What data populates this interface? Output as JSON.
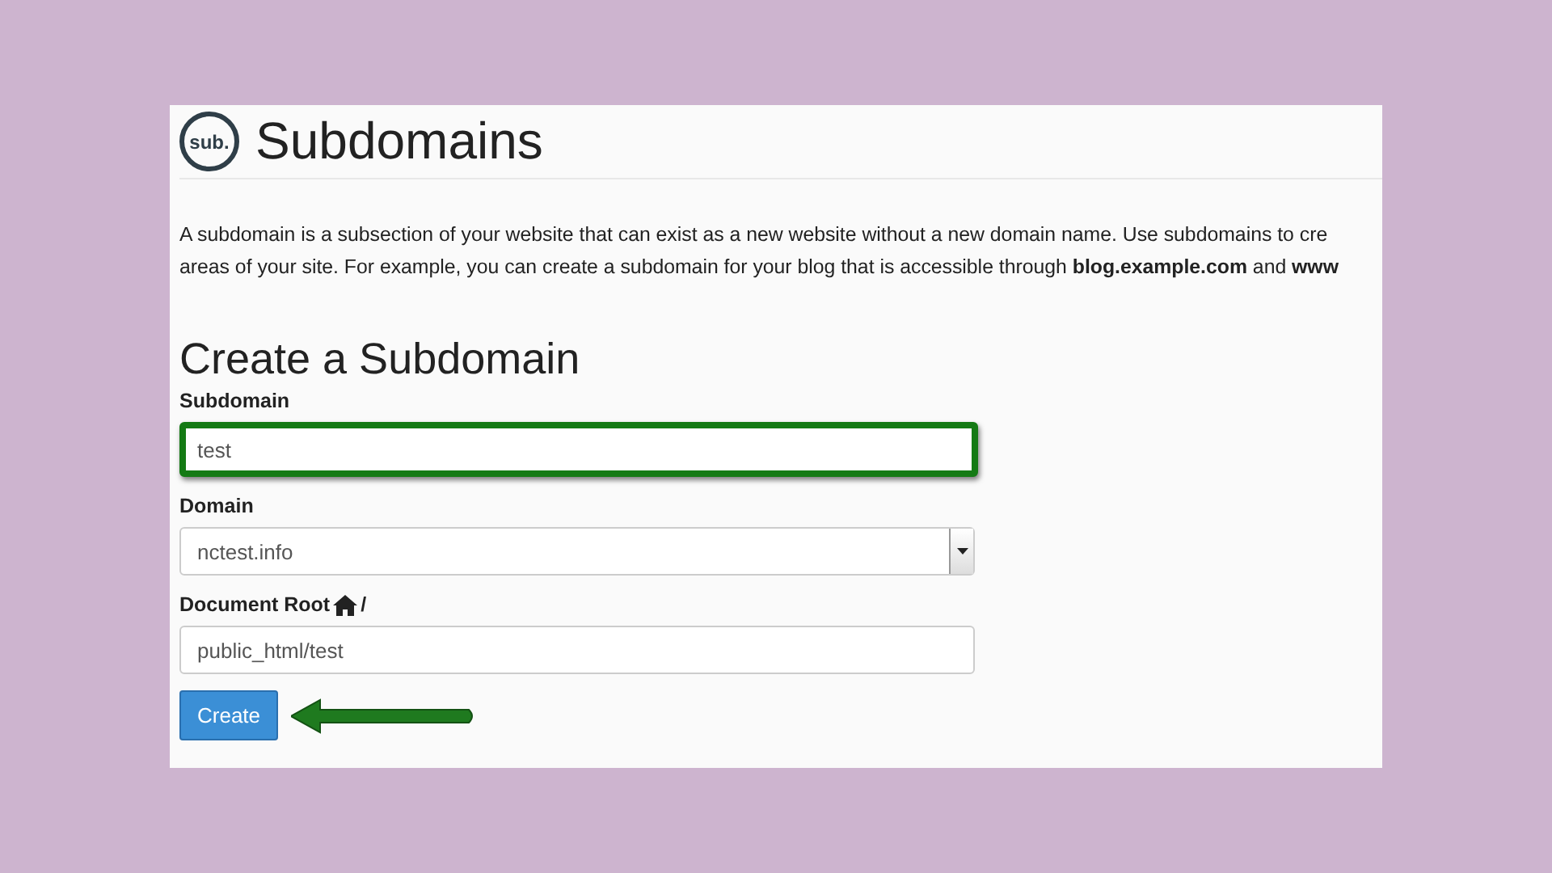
{
  "header": {
    "logo": "sub.",
    "title": "Subdomains"
  },
  "description": [
    "A subdomain is a subsection of your website that can exist as a new website without a new domain name. Use subdomains to cre",
    "areas of your site. For example, you can create a subdomain for your blog that is accessible through **blog.example.com** and **www**"
  ],
  "form": {
    "heading": "Create a Subdomain",
    "fields": [
      {
        "kind": "text",
        "label": "Subdomain",
        "value": "test",
        "highlighted": true
      },
      {
        "kind": "select",
        "label": "Domain",
        "value": "nctest.info",
        "highlighted": false
      },
      {
        "kind": "text",
        "label": "Document Root",
        "label_suffix": "/",
        "home_icon": true,
        "value": "public_html/test",
        "highlighted": false
      }
    ],
    "submit": {
      "label": "Create",
      "pointed_at": true
    }
  }
}
